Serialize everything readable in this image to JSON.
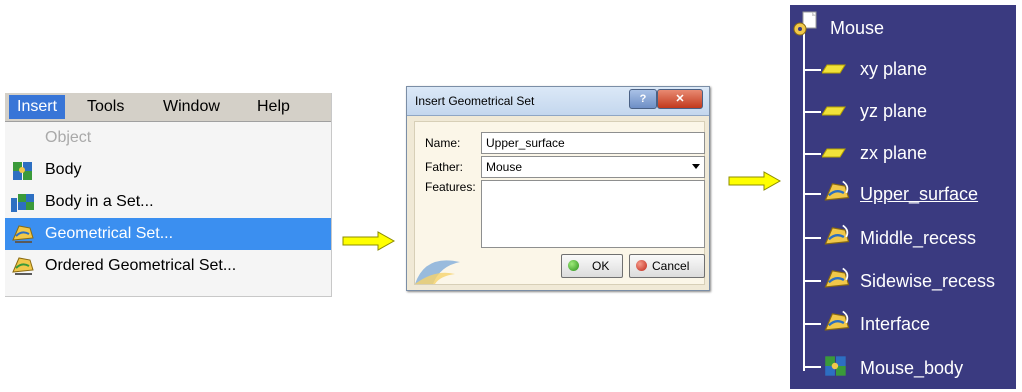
{
  "menu": {
    "bar": [
      "Insert",
      "Tools",
      "Window",
      "Help"
    ],
    "items": [
      {
        "label": "Object",
        "icon": "object-icon",
        "disabled": true
      },
      {
        "label": "Body",
        "icon": "body-icon"
      },
      {
        "label": "Body in a Set...",
        "icon": "body-in-set-icon"
      },
      {
        "label": "Geometrical Set...",
        "icon": "geometrical-set-icon",
        "selected": true
      },
      {
        "label": "Ordered Geometrical Set...",
        "icon": "ordered-geometrical-set-icon"
      }
    ]
  },
  "dialog": {
    "title": "Insert Geometrical Set",
    "help": "?",
    "close": "✕",
    "name_label": "Name:",
    "name_value": "Upper_surface",
    "father_label": "Father:",
    "father_value": "Mouse",
    "features_label": "Features:",
    "ok_label": "OK",
    "cancel_label": "Cancel"
  },
  "tree": {
    "root": "Mouse",
    "children": [
      {
        "label": "xy plane",
        "icon": "plane-icon"
      },
      {
        "label": "yz plane",
        "icon": "plane-icon"
      },
      {
        "label": "zx plane",
        "icon": "plane-icon"
      },
      {
        "label": "Upper_surface",
        "icon": "geometrical-set-icon",
        "highlighted": true
      },
      {
        "label": "Middle_recess",
        "icon": "geometrical-set-icon"
      },
      {
        "label": "Sidewise_recess",
        "icon": "geometrical-set-icon"
      },
      {
        "label": "Interface",
        "icon": "geometrical-set-icon"
      },
      {
        "label": "Mouse_body",
        "icon": "body-icon"
      }
    ]
  },
  "colors": {
    "menu_highlight": "#3b8ff0",
    "tree_bg": "#3a3a80",
    "arrow_fill": "#ffff00"
  }
}
